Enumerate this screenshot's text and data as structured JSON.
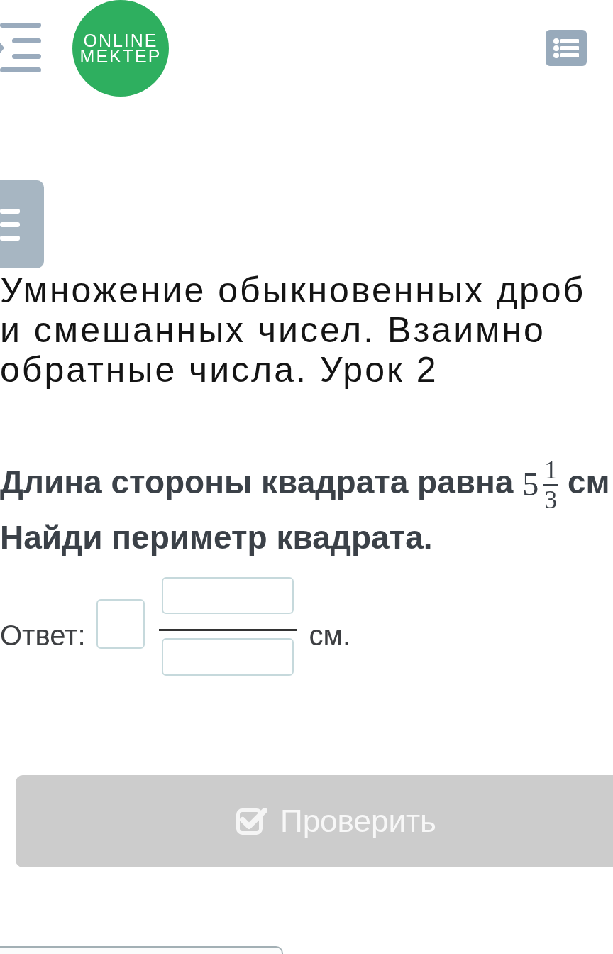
{
  "header": {
    "logo_text": [
      "ONLINE",
      "MEKTEP"
    ]
  },
  "lesson": {
    "title_lines": [
      "Умножение обыкновенных дроб",
      "и смешанных чисел. Взаимно",
      "обратные числа. Урок 2"
    ]
  },
  "question": {
    "line_1": {
      "text_before": "Длина стороны квадрата равна",
      "mixed_number": {
        "whole": "5",
        "numerator": "1",
        "denominator": "3"
      },
      "text_after": "см"
    },
    "line_2": "Найди периметр квадрата."
  },
  "answer": {
    "label": "Ответ:",
    "unit": "см."
  },
  "check_button": {
    "label": "Проверить",
    "disabled": true
  }
}
